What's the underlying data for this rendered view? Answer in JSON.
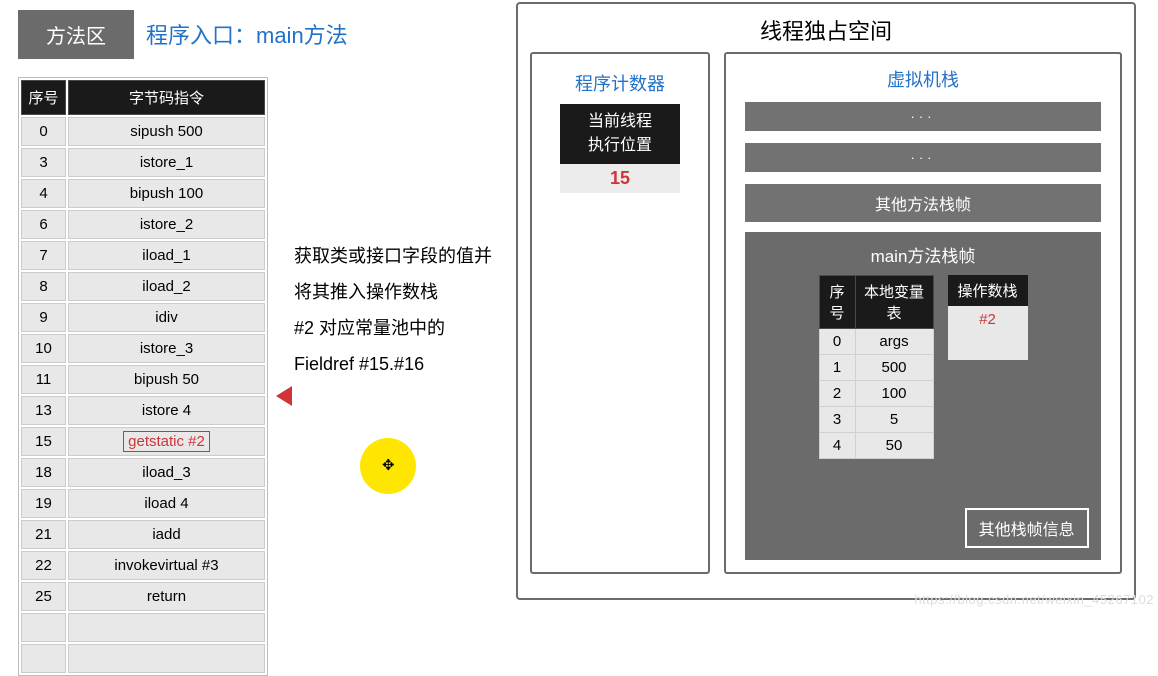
{
  "left": {
    "method_area_label": "方法区",
    "entry_label": "程序入口：main方法",
    "table": {
      "headers": {
        "seq": "序号",
        "ins": "字节码指令"
      },
      "rows": [
        {
          "seq": "0",
          "ins": "sipush 500"
        },
        {
          "seq": "3",
          "ins": "istore_1"
        },
        {
          "seq": "4",
          "ins": "bipush 100"
        },
        {
          "seq": "6",
          "ins": "istore_2"
        },
        {
          "seq": "7",
          "ins": "iload_1"
        },
        {
          "seq": "8",
          "ins": "iload_2"
        },
        {
          "seq": "9",
          "ins": "idiv"
        },
        {
          "seq": "10",
          "ins": "istore_3"
        },
        {
          "seq": "11",
          "ins": "bipush 50"
        },
        {
          "seq": "13",
          "ins": "istore 4"
        },
        {
          "seq": "15",
          "ins": "getstatic #2",
          "hl": true
        },
        {
          "seq": "18",
          "ins": "iload_3"
        },
        {
          "seq": "19",
          "ins": "iload 4"
        },
        {
          "seq": "21",
          "ins": "iadd"
        },
        {
          "seq": "22",
          "ins": "invokevirtual #3"
        },
        {
          "seq": "25",
          "ins": "return"
        }
      ]
    },
    "description": {
      "line1": "获取类或接口字段的值并将其推入操作数栈",
      "line2": "#2 对应常量池中的",
      "line3": "Fieldref   #15.#16"
    }
  },
  "right": {
    "title": "线程独占空间",
    "pc": {
      "title": "程序计数器",
      "box_line1": "当前线程",
      "box_line2": "执行位置",
      "value": "15"
    },
    "stack": {
      "title": "虚拟机栈",
      "bar": "···",
      "other_frame": "其他方法栈帧"
    },
    "main_frame": {
      "title": "main方法栈帧",
      "lvt": {
        "h1": "序号",
        "h2": "本地变量表",
        "rows": [
          {
            "n": "0",
            "v": "args"
          },
          {
            "n": "1",
            "v": "500"
          },
          {
            "n": "2",
            "v": "100"
          },
          {
            "n": "3",
            "v": "5"
          },
          {
            "n": "4",
            "v": "50"
          }
        ]
      },
      "ops": {
        "h": "操作数栈",
        "rows": [
          {
            "v": "#2",
            "red": true
          },
          {
            "v": ""
          }
        ]
      },
      "other_info": "其他栈帧信息"
    }
  },
  "watermark": "https://blog.csdn.net/weixin_45267102"
}
